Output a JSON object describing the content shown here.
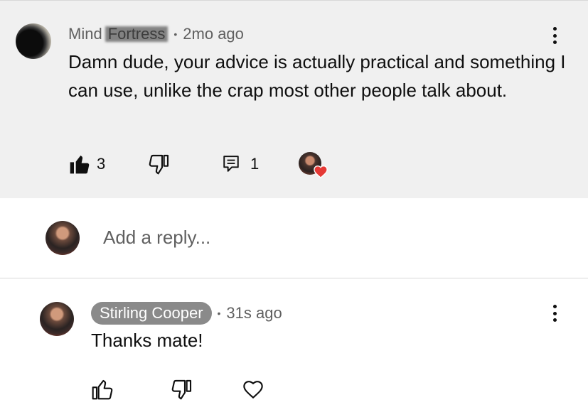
{
  "comment": {
    "author_visible": "Mind",
    "author_redacted": "Fortress",
    "timestamp": "2mo ago",
    "text": "Damn dude, your advice is actually practical and something I can use, unlike the crap most other people talk about.",
    "likes": "3",
    "replies": "1"
  },
  "reply_box": {
    "placeholder": "Add a reply..."
  },
  "reply": {
    "author": "Stirling Cooper",
    "timestamp": "31s ago",
    "text": "Thanks mate!"
  },
  "colors": {
    "comment_bg": "#f0f0f0",
    "secondary_text": "#606060",
    "badge_bg": "#8a8a8a",
    "heart": "#e53935"
  }
}
